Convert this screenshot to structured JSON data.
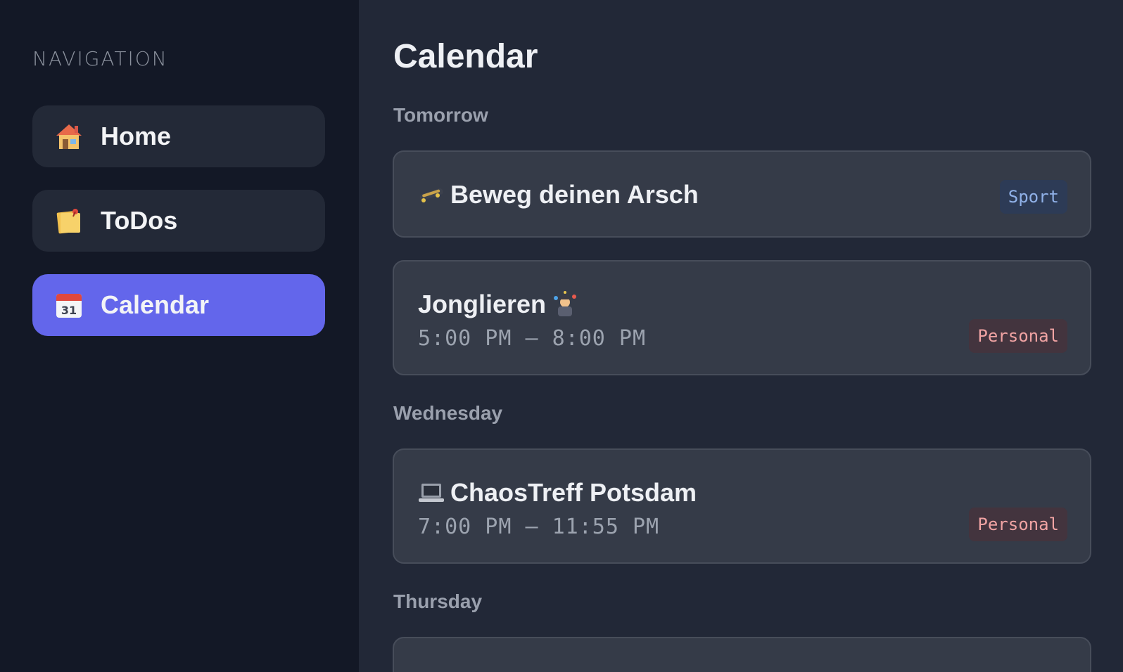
{
  "sidebar": {
    "heading": "NAVIGATION",
    "items": [
      {
        "label": "Home",
        "icon": "house-icon",
        "active": false
      },
      {
        "label": "ToDos",
        "icon": "memo-icon",
        "active": false
      },
      {
        "label": "Calendar",
        "icon": "calendar-icon",
        "active": true
      }
    ]
  },
  "main": {
    "title": "Calendar",
    "days": [
      {
        "label": "Tomorrow",
        "events": [
          {
            "title": "Beweg deinen Arsch",
            "icon": "skateboard-icon",
            "time": "",
            "tag": "Sport"
          },
          {
            "title": "Jonglieren",
            "icon": "juggler-icon",
            "time": "5:00 PM – 8:00 PM",
            "tag": "Personal"
          }
        ]
      },
      {
        "label": "Wednesday",
        "events": [
          {
            "title": "ChaosTreff Potsdam",
            "icon": "laptop-icon",
            "time": "7:00 PM – 11:55 PM",
            "tag": "Personal"
          }
        ]
      },
      {
        "label": "Thursday",
        "events": []
      }
    ]
  },
  "colors": {
    "sidebar_bg": "#131826",
    "main_bg": "#222837",
    "accent": "#6366eb",
    "card_bg": "#353b48",
    "sport_tag": "#90b1e8",
    "personal_tag": "#f0a3a3"
  }
}
